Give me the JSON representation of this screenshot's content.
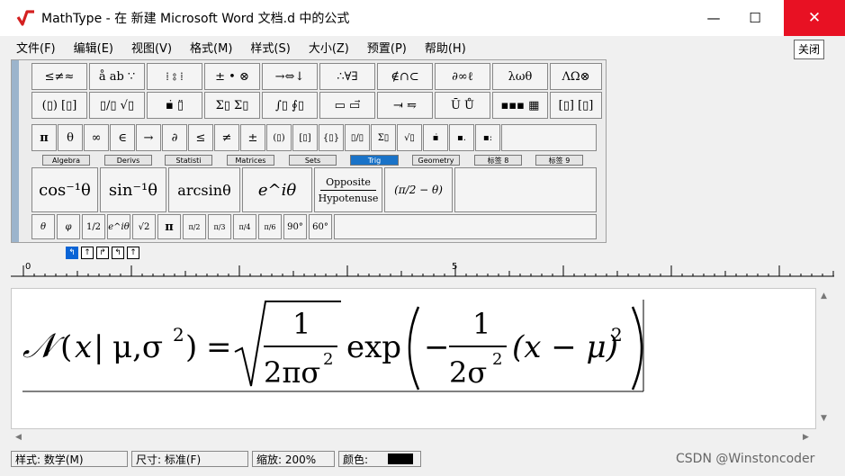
{
  "window": {
    "title": "MathType - 在 新建 Microsoft Word 文档.d 中的公式",
    "min_symbol": "—",
    "max_symbol": "☐",
    "close_symbol": "✕",
    "close_tooltip": "关闭"
  },
  "menu": [
    "文件(F)",
    "编辑(E)",
    "视图(V)",
    "格式(M)",
    "样式(S)",
    "大小(Z)",
    "预置(P)",
    "帮助(H)"
  ],
  "palette_row1": [
    "≤≠≈",
    "å ab ∵",
    "⁞ ⦂ ⁞",
    "± • ⊗",
    "→⇔↓",
    "∴∀∃",
    "∉∩⊂",
    "∂∞ℓ",
    "λωθ",
    "ΛΩ⊗"
  ],
  "palette_row2": [
    "(▯) [▯]",
    "▯/▯ √▯",
    "▪̇ ▯̈",
    "Σ▯ Σ▯",
    "∫▯ ∮▯",
    "▭ ▭⃗",
    "⥗ ⥧",
    "Ū Ů",
    "▪▪▪ ▦",
    "[▯] [▯]"
  ],
  "small_row": [
    "π",
    "θ",
    "∞",
    "∈",
    "→",
    "∂",
    "≤",
    "≠",
    "±",
    "(▯)",
    "[▯]",
    "{▯}",
    "▯/▯",
    "Σ▯",
    "√▯",
    "▪̇",
    "▪.",
    "▪:"
  ],
  "tabs": [
    "Algebra",
    "Derivs",
    "Statisti",
    "Matrices",
    "Sets",
    "Trig",
    "Geometry",
    "标签 8",
    "标签 9"
  ],
  "active_tab": "Trig",
  "trig_large": [
    "cos⁻¹θ",
    "sin⁻¹θ",
    "arcsinθ",
    "e^iθ",
    "Opposite/Hypotenuse",
    "(π/2 − θ)"
  ],
  "trig_large_opposite": "Opposite",
  "trig_large_hypotenuse": "Hypotenuse",
  "trig_small": [
    "θ",
    "φ",
    "1/2",
    "e^iθ",
    "√2",
    "π",
    "π/2",
    "π/3",
    "π/4",
    "π/6",
    "90°",
    "60°"
  ],
  "nudge_buttons": [
    "↰",
    "↑",
    "↱",
    "↰",
    "↑"
  ],
  "ruler": {
    "mark0": "0",
    "mark5": "5"
  },
  "formula": {
    "N": "𝒩",
    "lparen": "(",
    "x": "x",
    "sep": "|",
    "mu": "μ,σ",
    "sq": "2",
    "rparen": ")",
    "eq": "=",
    "one": "1",
    "den": "2πσ",
    "exp": "exp",
    "minus": "−",
    "den2": "2σ",
    "inner": "(x − μ)"
  },
  "status": {
    "style": "样式: 数学(M)",
    "size": "尺寸: 标准(F)",
    "zoom": "缩放: 200%",
    "color": "颜色:"
  },
  "colors": {
    "accent": "#1a73c8",
    "close": "#e81123"
  },
  "watermark": "CSDN @Winstoncoder"
}
